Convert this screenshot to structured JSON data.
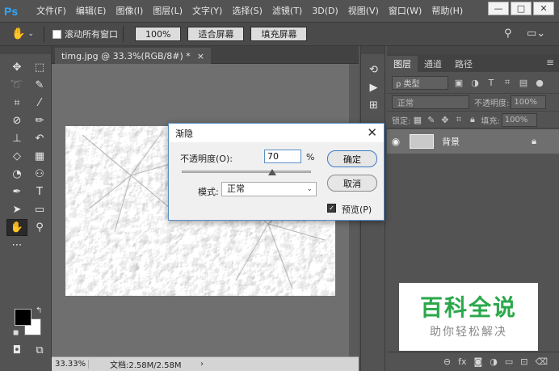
{
  "app": {
    "logo": "Ps"
  },
  "menu": {
    "items": [
      "文件(F)",
      "编辑(E)",
      "图像(I)",
      "图层(L)",
      "文字(Y)",
      "选择(S)",
      "滤镜(T)",
      "3D(D)",
      "视图(V)",
      "窗口(W)",
      "帮助(H)"
    ]
  },
  "window_controls": {
    "minimize": "—",
    "maximize": "□",
    "close": "✕"
  },
  "options_bar": {
    "scroll_all_label": "滚动所有窗口",
    "zoom_100": "100%",
    "fit_screen": "适合屏幕",
    "fill_screen": "填充屏幕"
  },
  "document": {
    "tab_title": "timg.jpg @ 33.3%(RGB/8#) *",
    "tab_close": "×",
    "status_zoom": "33.33%",
    "status_doc": "文档:2.58M/2.58M",
    "status_arrow": "›"
  },
  "layers_panel": {
    "tabs": [
      "图层",
      "通道",
      "路径"
    ],
    "kind": "ρ 类型",
    "blend_mode": "正常",
    "opacity_label": "不透明度:",
    "opacity_value": "100%",
    "lock_label": "锁定:",
    "fill_label": "填充:",
    "fill_value": "100%",
    "layer_name": "背景"
  },
  "dialog": {
    "title": "渐隐",
    "opacity_label": "不透明度(O):",
    "opacity_value": "70",
    "percent": "%",
    "mode_label": "模式:",
    "mode_value": "正常",
    "ok": "确定",
    "cancel": "取消",
    "preview_label": "预览(P)",
    "preview_checked": true,
    "slider_fraction": 0.7
  },
  "watermark": {
    "title": "百科全说",
    "subtitle": "助你轻松解决"
  },
  "colors": {
    "accent": "#31a8ff",
    "watermark_green": "#2aa84a",
    "dialog_border": "#5b8fc7"
  }
}
